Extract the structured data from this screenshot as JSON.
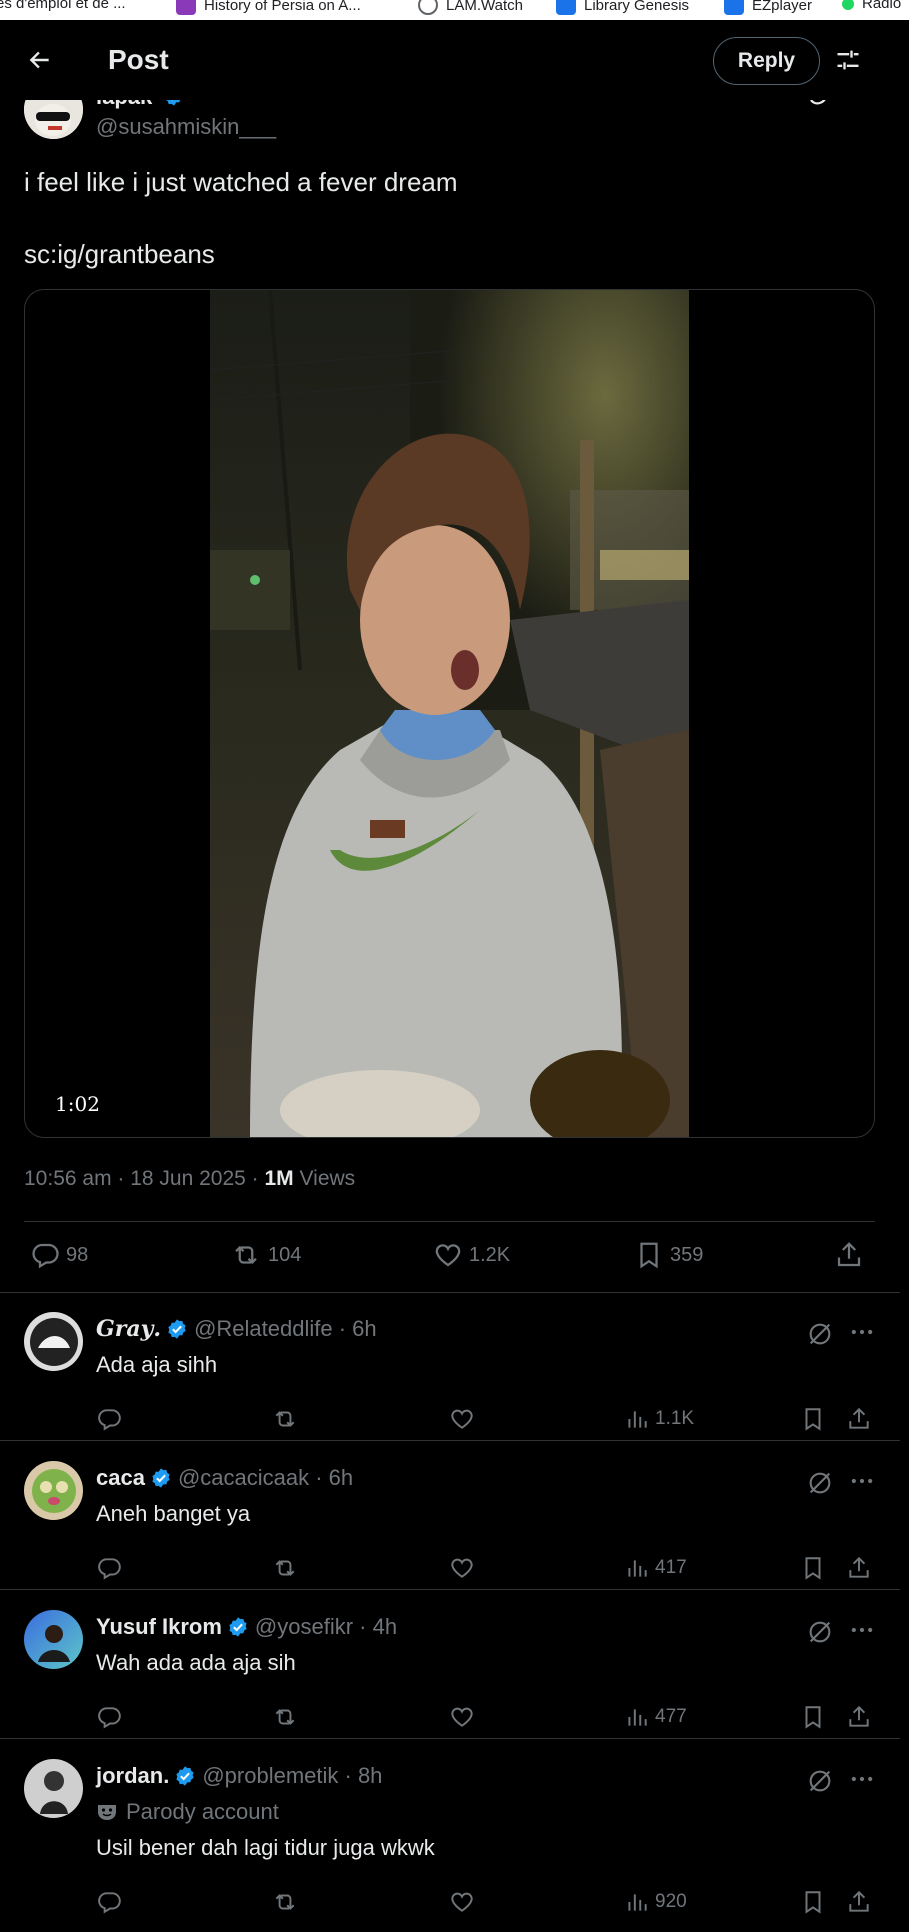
{
  "bookmarks": [
    {
      "label": "es d'emploi et de ...",
      "color": "#ffffff"
    },
    {
      "label": "History of Persia on A...",
      "color": "#8a3ab9"
    },
    {
      "label": "LAM.Watch",
      "color": "#5f6368"
    },
    {
      "label": "Library Genesis",
      "color": "#1a73e8"
    },
    {
      "label": "EZplayer",
      "color": "#1a73e8"
    },
    {
      "label": "Radio",
      "color": "#1ed760"
    }
  ],
  "header": {
    "title": "Post",
    "reply_label": "Reply"
  },
  "post": {
    "author_name": "lapak",
    "author_handle": "@susahmiskin___",
    "text_line1": "i feel like i just watched a fever dream",
    "text_line2": "sc:ig/grantbeans",
    "video_duration": "1:02",
    "time": "10:56 am · 18 Jun 2025 ·",
    "views_count": "1M",
    "views_label": "Views",
    "stats": {
      "replies": "98",
      "reposts": "104",
      "likes": "1.2K",
      "bookmarks": "359"
    }
  },
  "replies": [
    {
      "name": "𝑮𝒓𝒂𝒚.",
      "handle": "@Relateddlife · 6h",
      "text": "Ada aja sihh",
      "views": "1.1K",
      "parody": ""
    },
    {
      "name": "caca",
      "handle": "@cacacicaak · 6h",
      "text": "Aneh banget ya",
      "views": "417",
      "parody": ""
    },
    {
      "name": "Yusuf Ikrom",
      "handle": "@yosefikr · 4h",
      "text": "Wah ada ada aja sih",
      "views": "477",
      "parody": ""
    },
    {
      "name": "jordan.",
      "handle": "@problemetik · 8h",
      "text": "Usil bener dah lagi tidur juga wkwk",
      "views": "920",
      "parody": "Parody account"
    }
  ],
  "colors": {
    "background": "#000000",
    "text": "#e7e9ea",
    "muted": "#71767b",
    "border": "#2f3336",
    "verified": "#1d9bf0"
  }
}
